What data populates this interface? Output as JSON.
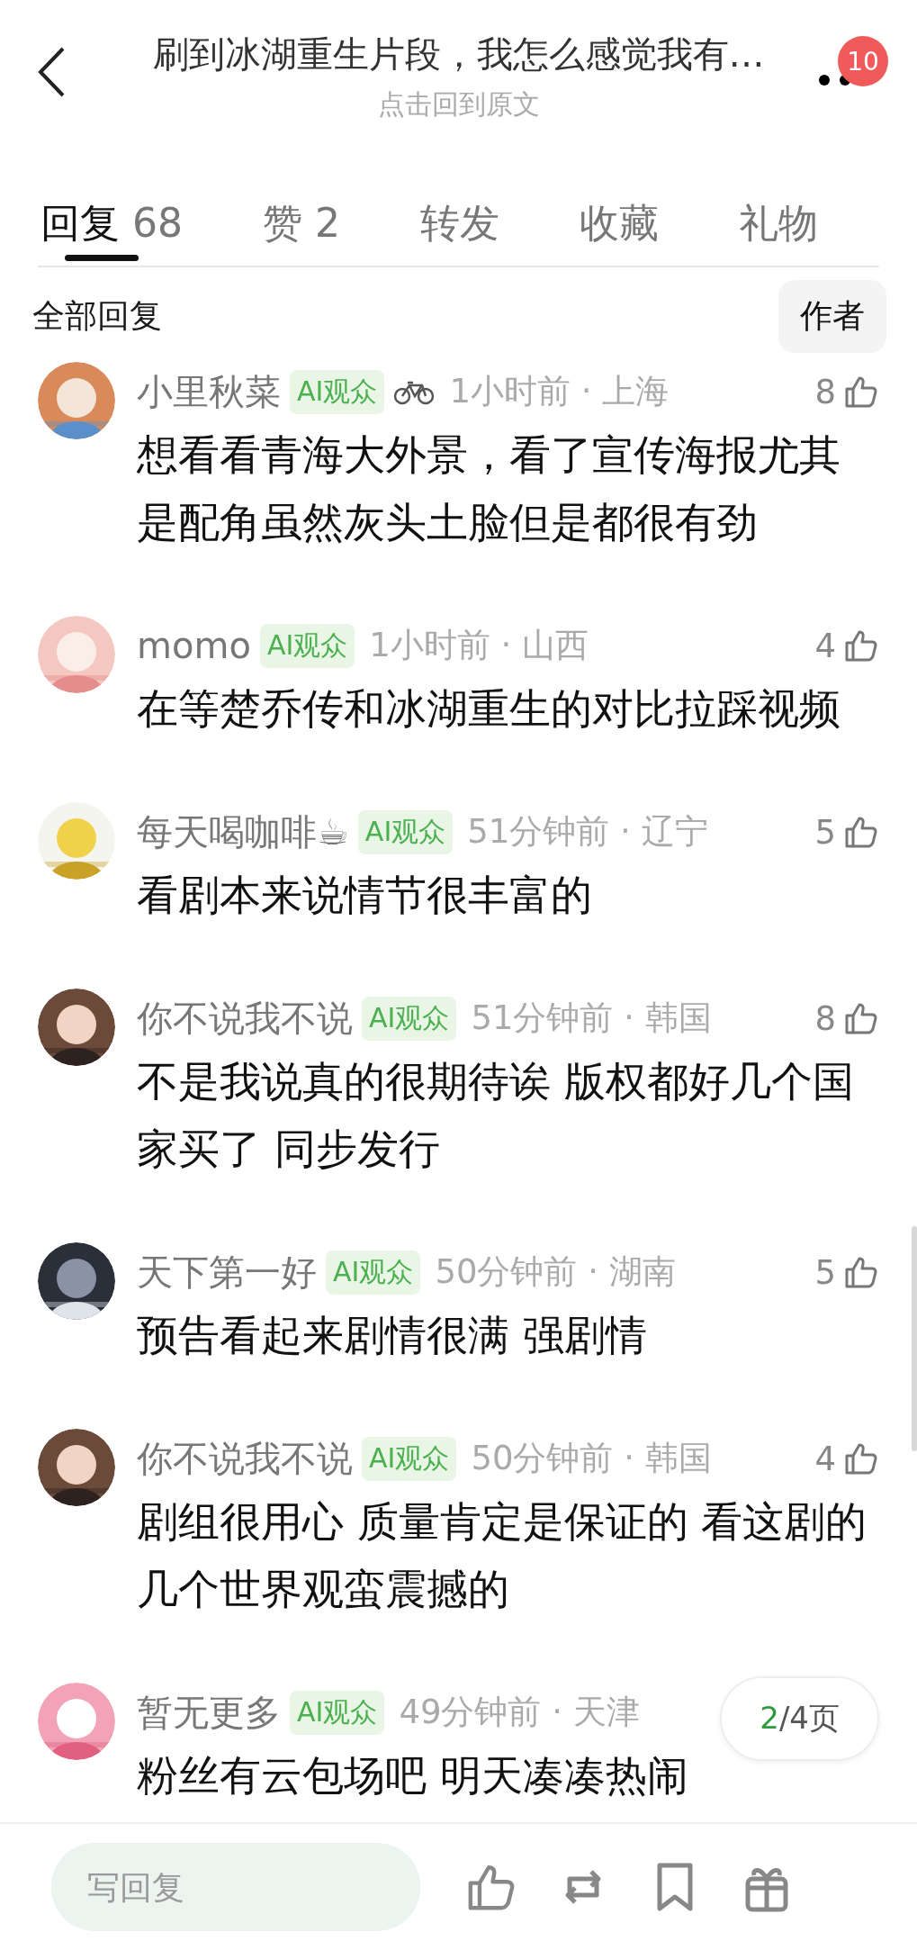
{
  "header": {
    "title": "刷到冰湖重生片段，我怎么感觉我有…",
    "subtitle": "点击回到原文",
    "notification_count": "10"
  },
  "tabs": [
    {
      "label": "回复",
      "count": "68",
      "selected": true
    },
    {
      "label": "赞",
      "count": "2",
      "selected": false
    },
    {
      "label": "转发",
      "selected": false
    },
    {
      "label": "收藏",
      "selected": false
    },
    {
      "label": "礼物",
      "selected": false
    }
  ],
  "section": {
    "title": "全部回复",
    "filter_button": "作者"
  },
  "comments": [
    {
      "name": "小里秋菜",
      "badge": "AI观众",
      "medal": true,
      "time_location": "1小时前 · 上海",
      "likes": "8",
      "text": "想看看青海大外景，看了宣传海报尤其是配角虽然灰头土脸但是都很有劲"
    },
    {
      "name": "momo",
      "badge": "AI观众",
      "medal": false,
      "time_location": "1小时前 · 山西",
      "likes": "4",
      "text": "在等楚乔传和冰湖重生的对比拉踩视频"
    },
    {
      "name": "每天喝咖啡☕",
      "badge": "AI观众",
      "medal": false,
      "time_location": "51分钟前 · 辽宁",
      "likes": "5",
      "text": "看剧本来说情节很丰富的"
    },
    {
      "name": "你不说我不说",
      "badge": "AI观众",
      "medal": false,
      "time_location": "51分钟前 · 韩国",
      "likes": "8",
      "text": "不是我说真的很期待诶 版权都好几个国家买了 同步发行"
    },
    {
      "name": "天下第一好",
      "badge": "AI观众",
      "medal": false,
      "time_location": "50分钟前 · 湖南",
      "likes": "5",
      "text": "预告看起来剧情很满 强剧情"
    },
    {
      "name": "你不说我不说",
      "badge": "AI观众",
      "medal": false,
      "time_location": "50分钟前 · 韩国",
      "likes": "4",
      "text": "剧组很用心 质量肯定是保证的 看这剧的几个世界观蛮震撼的"
    },
    {
      "name": "暂无更多",
      "badge": "AI观众",
      "medal": false,
      "time_location": "49分钟前 · 天津",
      "text": "粉丝有云包场吧 明天凑凑热闹"
    }
  ],
  "page_indicator": {
    "current": "2",
    "rest": "/4页"
  },
  "reply_bar": {
    "placeholder": "写回复"
  }
}
